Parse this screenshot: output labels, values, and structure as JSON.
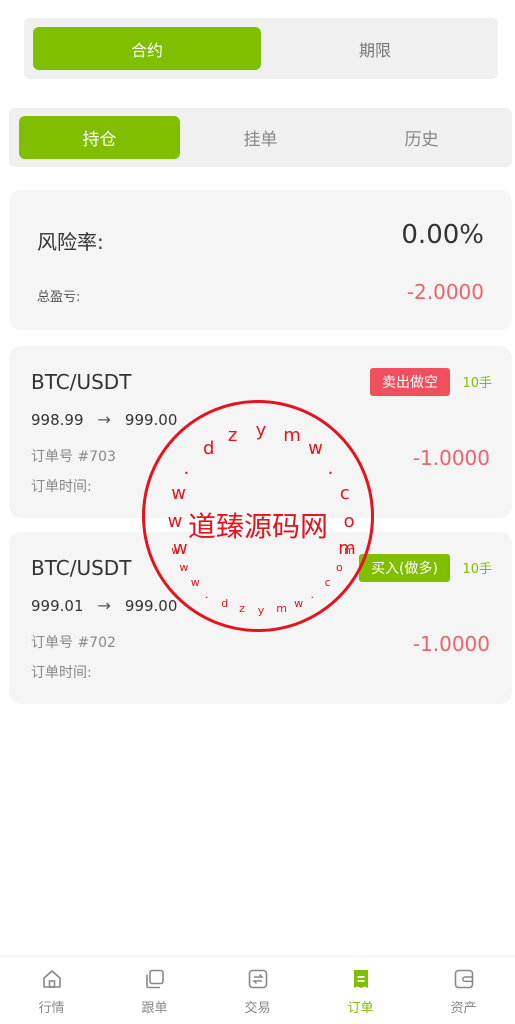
{
  "top_segment": {
    "items": [
      "合约",
      "期限"
    ],
    "active": 0
  },
  "sub_tabs": {
    "items": [
      "持仓",
      "挂单",
      "历史"
    ],
    "active": 0
  },
  "summary": {
    "risk_label": "风险率:",
    "risk_value": "0.00%",
    "pnl_label": "总盈亏:",
    "pnl_value": "-2.0000"
  },
  "positions": [
    {
      "symbol": "BTC/USDT",
      "side_label": "卖出做空",
      "side": "short",
      "leverage": "10手",
      "open_price": "998.99",
      "arrow": "→",
      "current_price": "999.00",
      "order_label": "订单号 #703",
      "time_label": "订单时间:",
      "pnl": "-1.0000"
    },
    {
      "symbol": "BTC/USDT",
      "side_label": "买入(做多)",
      "side": "long",
      "leverage": "10手",
      "open_price": "999.01",
      "arrow": "→",
      "current_price": "999.00",
      "order_label": "订单号 #702",
      "time_label": "订单时间:",
      "pnl": "-1.0000"
    }
  ],
  "watermark": {
    "main_text": "道臻源码网",
    "ring_text": "www.dzymw.com",
    "color": "#e4141e"
  },
  "tabbar": {
    "items": [
      {
        "label": "行情",
        "icon": "home-icon"
      },
      {
        "label": "跟单",
        "icon": "copy-icon"
      },
      {
        "label": "交易",
        "icon": "exchange-icon"
      },
      {
        "label": "订单",
        "icon": "orders-icon"
      },
      {
        "label": "资产",
        "icon": "wallet-icon"
      }
    ],
    "active": 3
  },
  "colors": {
    "accent": "#7fbf00",
    "loss": "#f0616b",
    "short_badge": "#ef4f5f",
    "long_badge": "#7fbf00"
  }
}
